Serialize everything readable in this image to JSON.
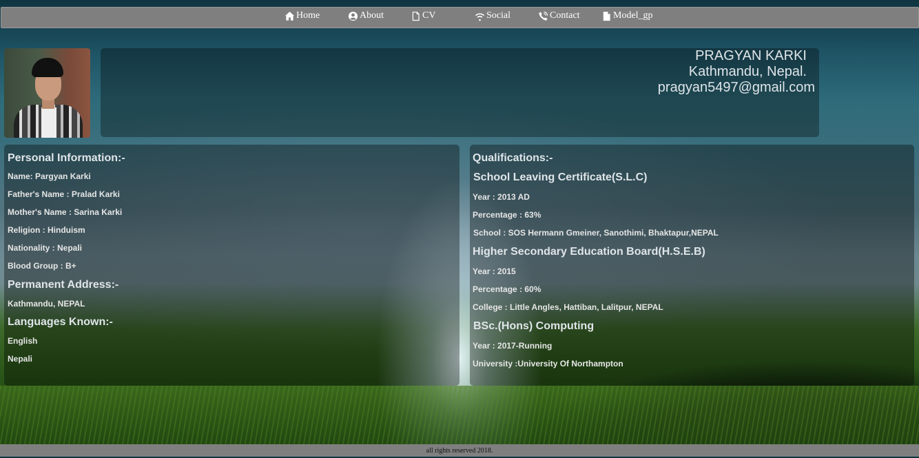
{
  "nav": {
    "items": [
      {
        "label": "Home",
        "icon": "home-icon"
      },
      {
        "label": "About",
        "icon": "user-circle-icon"
      },
      {
        "label": "CV",
        "icon": "file-icon"
      },
      {
        "label": "Social",
        "icon": "wifi-icon"
      },
      {
        "label": "Contact",
        "icon": "phone-icon"
      },
      {
        "label": "Model_gp",
        "icon": "file-filled-icon"
      }
    ]
  },
  "header": {
    "name": "PRAGYAN KARKI",
    "location": "Kathmandu, Nepal.",
    "email": "pragyan5497@gmail.com"
  },
  "personal": {
    "title": "Personal Information:-",
    "rows": [
      "Name: Pargyan Karki",
      "Father's Name : Pralad Karki",
      "Mother's Name : Sarina Karki",
      "Religion : Hinduism",
      "Nationality : Nepali",
      "Blood Group : B+"
    ],
    "address_title": "Permanent Address:-",
    "address": "Kathmandu, NEPAL",
    "languages_title": "Languages Known:-",
    "languages": [
      "English",
      "Nepali"
    ]
  },
  "qualifications": {
    "title": "Qualifications:-",
    "slc": {
      "title": "School Leaving Certificate(S.L.C)",
      "year": "Year : 2013 AD",
      "percentage": "Percentage : 63%",
      "school": "School : SOS Hermann Gmeiner, Sanothimi, Bhaktapur,NEPAL"
    },
    "hseb": {
      "title": "Higher Secondary Education Board(H.S.E.B)",
      "year": "Year : 2015",
      "percentage": "Percentage : 60%",
      "college": "College : Little Angles, Hattiban, Lalitpur, NEPAL"
    },
    "bsc": {
      "title": "BSc.(Hons) Computing",
      "year": "Year : 2017-Running",
      "university": "University :University Of Northampton"
    }
  },
  "footer": {
    "text": "all rights reserved 2018."
  },
  "colors": {
    "nav_bg": "#7f7f7f",
    "text": "#dfe5e9"
  }
}
